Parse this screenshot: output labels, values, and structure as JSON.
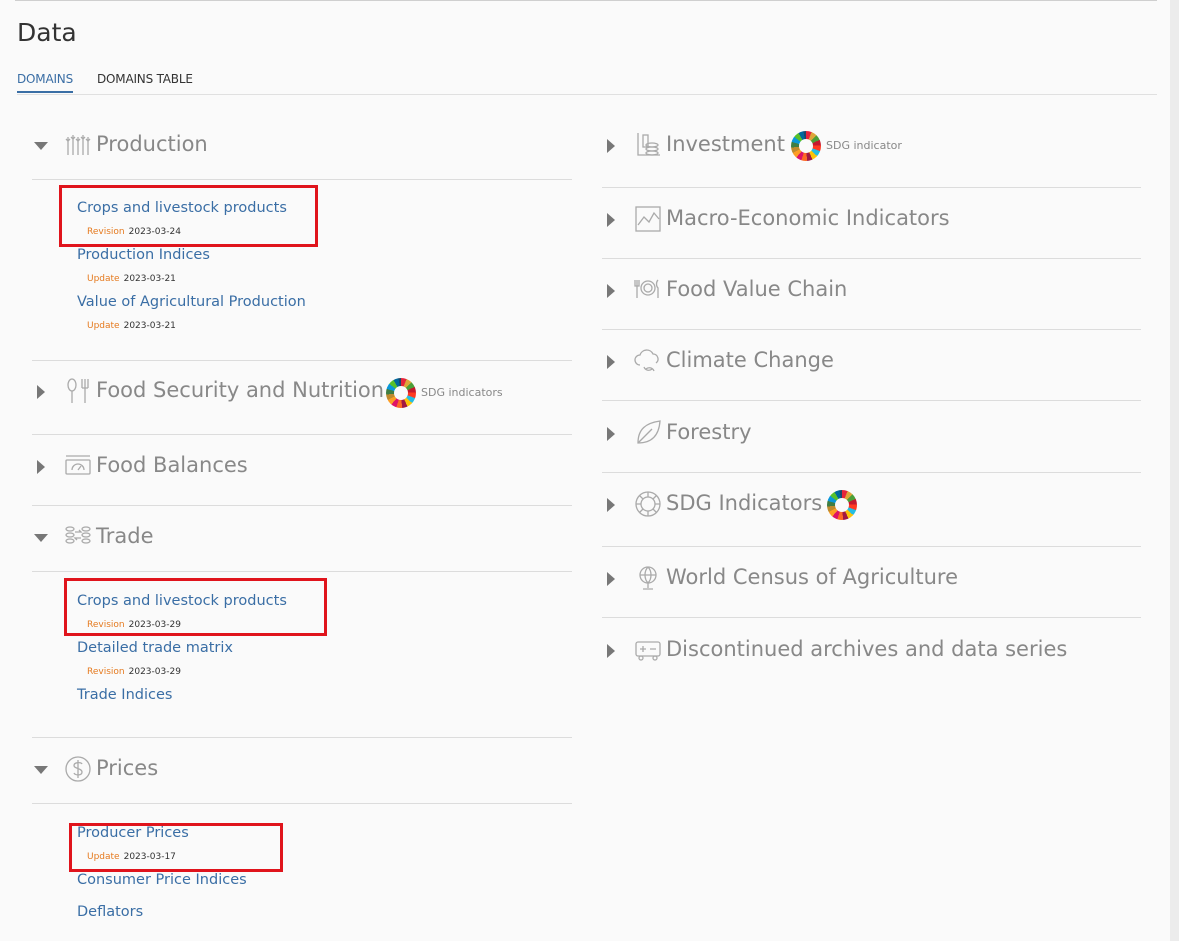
{
  "page": {
    "title": "Data"
  },
  "tabs": [
    {
      "label": "DOMAINS"
    },
    {
      "label": "DOMAINS TABLE"
    }
  ],
  "left": {
    "production": {
      "label": "Production",
      "items": [
        {
          "label": "Crops and livestock products",
          "tag": "Revision",
          "date": "2023-03-24"
        },
        {
          "label": "Production Indices",
          "tag": "Update",
          "date": "2023-03-21"
        },
        {
          "label": "Value of Agricultural Production",
          "tag": "Update",
          "date": "2023-03-21"
        }
      ]
    },
    "food_security": {
      "label": "Food Security and Nutrition",
      "sdg_label": "SDG indicators"
    },
    "food_balances": {
      "label": "Food Balances"
    },
    "trade": {
      "label": "Trade",
      "items": [
        {
          "label": "Crops and livestock products",
          "tag": "Revision",
          "date": "2023-03-29"
        },
        {
          "label": "Detailed trade matrix",
          "tag": "Revision",
          "date": "2023-03-29"
        },
        {
          "label": "Trade Indices"
        }
      ]
    },
    "prices": {
      "label": "Prices",
      "items": [
        {
          "label": "Producer Prices",
          "tag": "Update",
          "date": "2023-03-17"
        },
        {
          "label": "Consumer Price Indices"
        },
        {
          "label": "Deflators"
        }
      ]
    }
  },
  "right": {
    "investment": {
      "label": "Investment",
      "sdg_label": "SDG indicator"
    },
    "macro": {
      "label": "Macro-Economic Indicators"
    },
    "food_value_chain": {
      "label": "Food Value Chain"
    },
    "climate": {
      "label": "Climate Change"
    },
    "forestry": {
      "label": "Forestry"
    },
    "sdg": {
      "label": "SDG Indicators"
    },
    "census": {
      "label": "World Census of Agriculture"
    },
    "discontinued": {
      "label": "Discontinued archives and data series"
    }
  },
  "colors": {
    "link": "#3a6ea5",
    "tag": "#e57a1f",
    "highlight": "#e0141c",
    "heading": "#888888"
  }
}
